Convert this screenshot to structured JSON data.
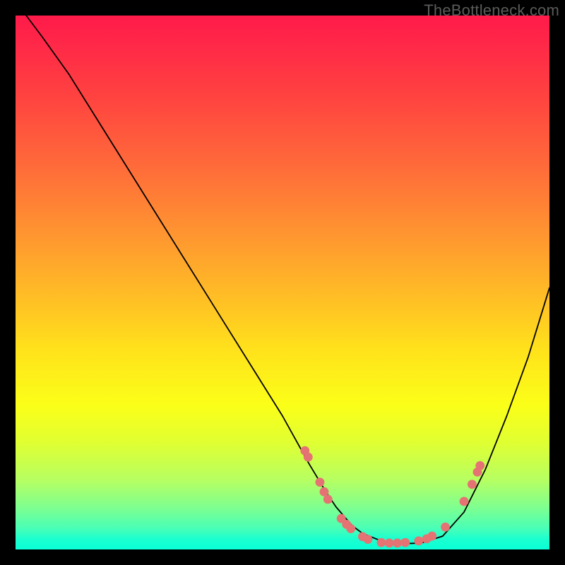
{
  "watermark": "TheBottleneck.com",
  "chart_data": {
    "type": "line",
    "title": "",
    "xlabel": "",
    "ylabel": "",
    "xlim": [
      0,
      100
    ],
    "ylim": [
      0,
      100
    ],
    "grid": false,
    "legend": false,
    "series": [
      {
        "name": "curve",
        "x": [
          2,
          5,
          10,
          15,
          20,
          25,
          30,
          35,
          40,
          45,
          50,
          55,
          58,
          60,
          63,
          65,
          68,
          70,
          73,
          76,
          80,
          84,
          88,
          92,
          96,
          100
        ],
        "y": [
          100,
          96,
          89,
          81,
          73,
          65,
          57,
          49,
          41,
          33,
          25,
          16,
          11,
          8,
          4.5,
          3,
          1.8,
          1.3,
          1.1,
          1.2,
          2.5,
          7,
          15,
          25,
          36,
          49
        ]
      }
    ],
    "markers": [
      {
        "x": 54.2,
        "y": 18.5
      },
      {
        "x": 54.8,
        "y": 17.3
      },
      {
        "x": 57.0,
        "y": 12.6
      },
      {
        "x": 57.8,
        "y": 10.8
      },
      {
        "x": 58.5,
        "y": 9.4
      },
      {
        "x": 61.0,
        "y": 5.8
      },
      {
        "x": 62.0,
        "y": 4.7
      },
      {
        "x": 62.8,
        "y": 3.9
      },
      {
        "x": 65.0,
        "y": 2.4
      },
      {
        "x": 66.0,
        "y": 1.9
      },
      {
        "x": 68.5,
        "y": 1.3
      },
      {
        "x": 70.0,
        "y": 1.2
      },
      {
        "x": 71.5,
        "y": 1.2
      },
      {
        "x": 73.0,
        "y": 1.3
      },
      {
        "x": 75.5,
        "y": 1.6
      },
      {
        "x": 77.0,
        "y": 2.0
      },
      {
        "x": 78.0,
        "y": 2.5
      },
      {
        "x": 80.5,
        "y": 4.2
      },
      {
        "x": 84.0,
        "y": 9.0
      },
      {
        "x": 85.5,
        "y": 12.2
      },
      {
        "x": 86.5,
        "y": 14.5
      },
      {
        "x": 87.0,
        "y": 15.7
      }
    ],
    "marker_radius_percent": 0.85
  },
  "gradient_stops": [
    {
      "pos": 0,
      "color": "#ff1a4a"
    },
    {
      "pos": 100,
      "color": "#0affd6"
    }
  ]
}
